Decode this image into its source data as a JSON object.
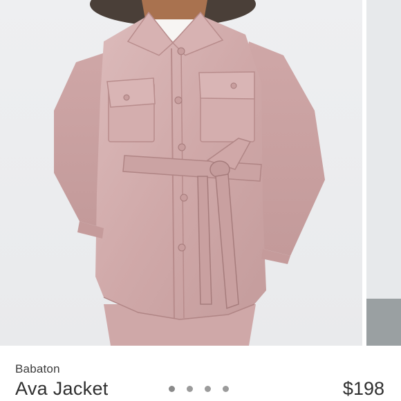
{
  "listing": {
    "brand": "Babaton",
    "title": "Ava Jacket",
    "price": "$198"
  },
  "carousel": {
    "slide_count": 4,
    "active_index": 0
  },
  "colors": {
    "jacket": "#d3aeae",
    "background": "#ecedef",
    "text": "#2f2f2f",
    "dot": "#9b9b9b"
  }
}
